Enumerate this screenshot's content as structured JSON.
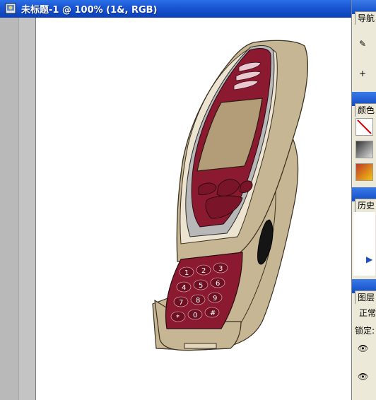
{
  "document_window": {
    "title": "未标题-1 @ 100% (1&, RGB)"
  },
  "panels": {
    "navigator": {
      "tab_label": "导航"
    },
    "color": {
      "tab_label": "颜色"
    },
    "history": {
      "tab_label": "历史"
    },
    "layers": {
      "tab_label": "图层",
      "blend_mode": "正常",
      "lock_label": "锁定:"
    }
  },
  "keypad": {
    "keys": [
      "1",
      "2",
      "3",
      "4",
      "5",
      "6",
      "7",
      "8",
      "9",
      "*",
      "0",
      "#"
    ]
  },
  "colors": {
    "phone_body": "#c2b08e",
    "phone_red": "#8b1a30",
    "screen": "#b39d78",
    "silver": "#b8b8b8",
    "titlebar": "#1a56d4"
  }
}
